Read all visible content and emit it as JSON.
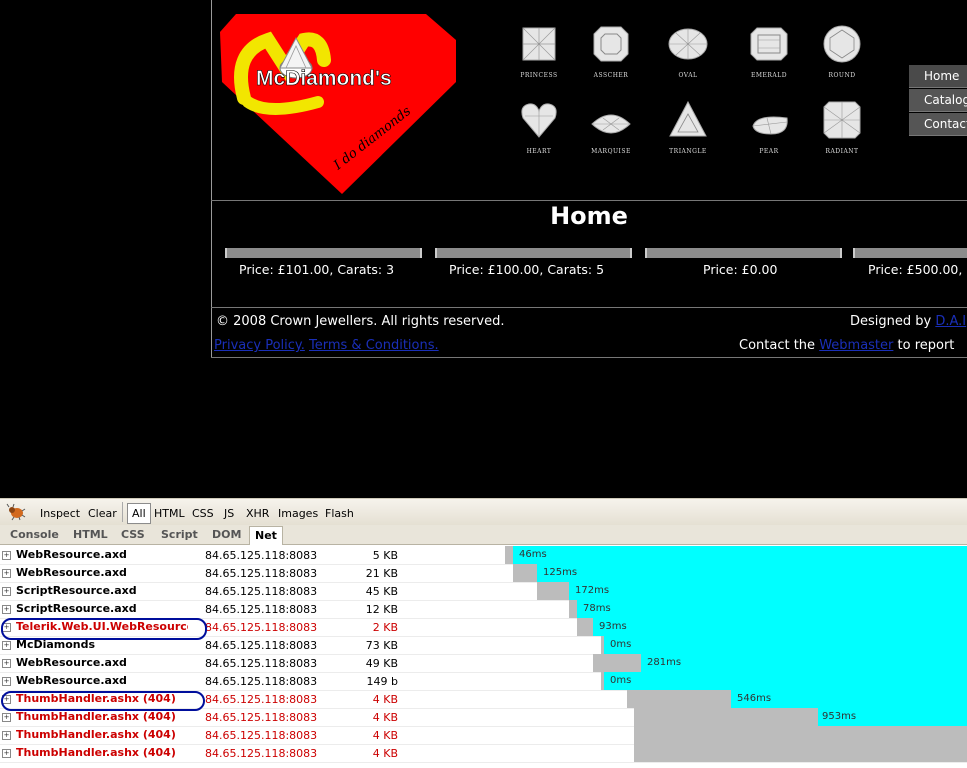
{
  "site": {
    "logo_text": "McDiamond's",
    "logo_tagline": "I do diamonds",
    "diamond_shapes": [
      "PRINCESS",
      "ASSCHER",
      "OVAL",
      "EMERALD",
      "ROUND",
      "HEART",
      "MARQUISE",
      "TRIANGLE",
      "PEAR",
      "RADIANT"
    ],
    "nav": [
      "Home",
      "Catalog",
      "Contact"
    ],
    "page_title": "Home",
    "products": [
      {
        "label": "Price: £101.00, Carats: 3"
      },
      {
        "label": "Price: £100.00, Carats: 5"
      },
      {
        "label": "Price: £0.00"
      },
      {
        "label": "Price: £500.00,"
      }
    ],
    "footer": {
      "copyright": "© 2008 Crown Jewellers. All rights reserved.",
      "designed_by": "Designed by",
      "designer_link": "D.A.I",
      "privacy": "Privacy Policy.",
      "terms": "Terms & Conditions.",
      "contact_prefix": "Contact the",
      "webmaster": "Webmaster",
      "contact_suffix": "to report"
    },
    "colors": {
      "logo_red": "#ff0000",
      "logo_yellow": "#f2e600",
      "link": "#1a2fb8",
      "nav_bg": "#555555"
    }
  },
  "firebug": {
    "toolbar": [
      "Inspect",
      "Clear",
      "All",
      "HTML",
      "CSS",
      "JS",
      "XHR",
      "Images",
      "Flash"
    ],
    "toolbar_selected": "All",
    "panels": [
      "Console",
      "HTML",
      "CSS",
      "Script",
      "DOM",
      "Net"
    ],
    "panel_selected": "Net",
    "requests": [
      {
        "url": "WebResource.axd",
        "host": "84.65.125.118:8083",
        "size": "5 KB",
        "time": "46ms",
        "error": false
      },
      {
        "url": "WebResource.axd",
        "host": "84.65.125.118:8083",
        "size": "21 KB",
        "time": "125ms",
        "error": false
      },
      {
        "url": "ScriptResource.axd",
        "host": "84.65.125.118:8083",
        "size": "45 KB",
        "time": "172ms",
        "error": false
      },
      {
        "url": "ScriptResource.axd",
        "host": "84.65.125.118:8083",
        "size": "12 KB",
        "time": "78ms",
        "error": false
      },
      {
        "url": "Telerik.Web.UI.WebResource.a",
        "host": "84.65.125.118:8083",
        "size": "2 KB",
        "time": "93ms",
        "error": true
      },
      {
        "url": "McDiamonds",
        "host": "84.65.125.118:8083",
        "size": "73 KB",
        "time": "0ms",
        "error": false
      },
      {
        "url": "WebResource.axd",
        "host": "84.65.125.118:8083",
        "size": "49 KB",
        "time": "281ms",
        "error": false
      },
      {
        "url": "WebResource.axd",
        "host": "84.65.125.118:8083",
        "size": "149 b",
        "time": "0ms",
        "error": false
      },
      {
        "url": "ThumbHandler.ashx (404)",
        "host": "84.65.125.118:8083",
        "size": "4 KB",
        "time": "546ms",
        "error": true
      },
      {
        "url": "ThumbHandler.ashx (404)",
        "host": "84.65.125.118:8083",
        "size": "4 KB",
        "time": "953ms",
        "error": true
      },
      {
        "url": "ThumbHandler.ashx (404)",
        "host": "84.65.125.118:8083",
        "size": "4 KB",
        "time": "",
        "error": true
      },
      {
        "url": "ThumbHandler.ashx (404)",
        "host": "84.65.125.118:8083",
        "size": "4 KB",
        "time": "",
        "error": true
      }
    ],
    "colors": {
      "error": "#cc0000",
      "receive_bar": "#00ffff",
      "wait_bar": "#bcbcbc",
      "highlight_ring": "#000e9c"
    }
  }
}
